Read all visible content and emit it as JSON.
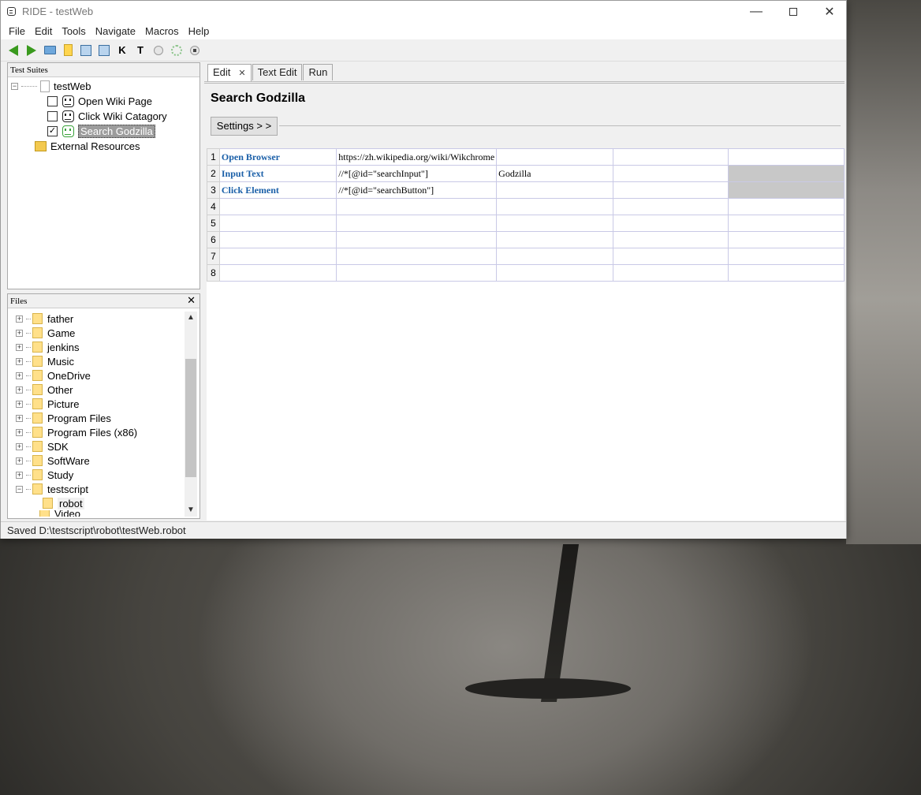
{
  "window": {
    "title": "RIDE - testWeb",
    "controls": {
      "minimize": "—",
      "close": "✕"
    }
  },
  "menubar": [
    "File",
    "Edit",
    "Tools",
    "Navigate",
    "Macros",
    "Help"
  ],
  "toolbar": {
    "keyword_button": "K",
    "testcase_button": "T"
  },
  "suites_panel": {
    "header": "Test Suites",
    "root": "testWeb",
    "tests": [
      {
        "label": "Open Wiki Page",
        "checked": false
      },
      {
        "label": "Click Wiki Catagory",
        "checked": false
      },
      {
        "label": "Search Godzilla",
        "checked": true
      }
    ],
    "check_mark": "✓",
    "external": "External Resources"
  },
  "files_panel": {
    "header": "Files",
    "close": "✕",
    "folders": [
      "father",
      "Game",
      "jenkins",
      "Music",
      "OneDrive",
      "Other",
      "Picture",
      "Program Files",
      "Program Files (x86)",
      "SDK",
      "SoftWare",
      "Study",
      "testscript"
    ],
    "child_folder": "robot",
    "cut_off_folder": "Video",
    "scroll_up": "▲",
    "scroll_down": "▼"
  },
  "tabs": [
    {
      "label": "Edit",
      "close": "✕"
    },
    {
      "label": "Text Edit"
    },
    {
      "label": "Run"
    }
  ],
  "editor": {
    "title": "Search Godzilla",
    "settings_button": "Settings > >",
    "rows": [
      {
        "num": "1",
        "cells": [
          "Open Browser",
          "https://zh.wikipedia.org/wiki/Wikchrome",
          "",
          "",
          ""
        ]
      },
      {
        "num": "2",
        "cells": [
          "Input Text",
          "//*[@id=\"searchInput\"]",
          "Godzilla",
          "",
          ""
        ]
      },
      {
        "num": "3",
        "cells": [
          "Click Element",
          "//*[@id=\"searchButton\"]",
          "",
          "",
          ""
        ]
      },
      {
        "num": "4",
        "cells": [
          "",
          "",
          "",
          "",
          ""
        ]
      },
      {
        "num": "5",
        "cells": [
          "",
          "",
          "",
          "",
          ""
        ]
      },
      {
        "num": "6",
        "cells": [
          "",
          "",
          "",
          "",
          ""
        ]
      },
      {
        "num": "7",
        "cells": [
          "",
          "",
          "",
          "",
          ""
        ]
      },
      {
        "num": "8",
        "cells": [
          "",
          "",
          "",
          "",
          ""
        ]
      }
    ]
  },
  "statusbar": {
    "text": "Saved D:\\testscript\\robot\\testWeb.robot"
  },
  "colors": {
    "keyword": "#1a5fa8",
    "selected": "#9c9c9c",
    "accent_green": "#3a9a1e"
  }
}
